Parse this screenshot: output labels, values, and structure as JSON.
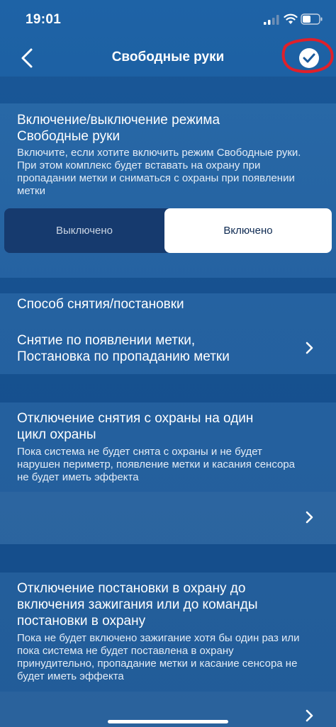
{
  "status_bar": {
    "time": "19:01",
    "icons": [
      "signal-icon",
      "wifi-icon",
      "battery-icon"
    ]
  },
  "nav": {
    "title": "Свободные руки",
    "back_icon": "chevron-left-icon",
    "confirm_icon": "check-circle-icon"
  },
  "mode_section": {
    "title_line1": "Включение/выключение режима",
    "title_line2": "Свободные руки",
    "desc_line1": "Включите, если хотите включить режим Свободные руки.",
    "desc_line2": "При этом комплекс будет вставать на охрану при",
    "desc_line3": "пропадании метки и сниматься с охраны при появлении",
    "desc_line4": "метки",
    "segments": {
      "off": "Выключено",
      "on": "Включено",
      "selected": "on"
    }
  },
  "method_section": {
    "title": "Способ снятия/постановки",
    "value_line1": "Снятие по появлении метки,",
    "value_line2": "Постановка по пропаданию метки"
  },
  "disarm_section": {
    "title_line1": "Отключение снятия с охраны на один",
    "title_line2": "цикл охраны",
    "desc_line1": "Пока система не будет снята с охраны и не будет",
    "desc_line2": "нарушен периметр, появление метки и касания сенсора",
    "desc_line3": "не будет иметь эффекта"
  },
  "ignition_section": {
    "title_line1": "Отключение постановки в охрану до",
    "title_line2": "включения зажигания или до команды",
    "title_line3": "постановки в охрану",
    "desc_line1": "Пока не будет включено зажигание хотя бы один раз или",
    "desc_line2": "пока система не будет поставлена в охрану",
    "desc_line3": "принудительно, пропадание метки и касание сенсора не",
    "desc_line4": "будет иметь эффекта"
  },
  "colors": {
    "background": "#1a5a9c",
    "segment_bg": "#163a6e",
    "annotation": "#e0202a"
  }
}
